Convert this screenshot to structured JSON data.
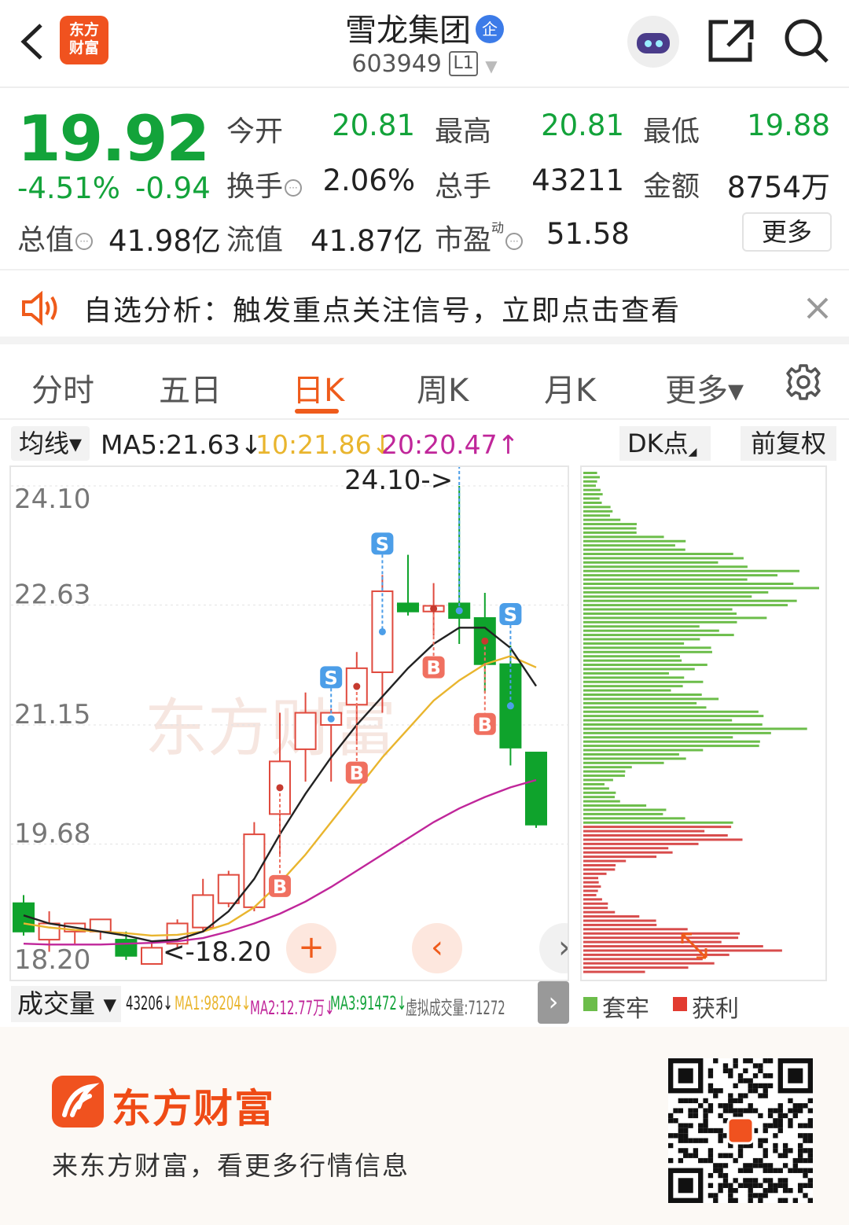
{
  "header": {
    "back_icon": "chevron-left-icon",
    "app_logo_text": "东方\n财富",
    "stock_name": "雪龙集团",
    "enterprise_badge": "企",
    "stock_code": "603949",
    "level_badge": "L1",
    "share_icon": "share-icon",
    "search_icon": "search-icon"
  },
  "quote": {
    "price": "19.92",
    "change_pct": "-4.51%",
    "change_amt": "-0.94",
    "open_label": "今开",
    "open_value": "20.81",
    "high_label": "最高",
    "high_value": "20.81",
    "low_label": "最低",
    "low_value": "19.88",
    "turnover_label": "换手",
    "turnover_value": "2.06%",
    "volume_label": "总手",
    "volume_value": "43211",
    "amount_label": "金额",
    "amount_value": "8754万",
    "mcap_label": "总值",
    "mcap_value": "41.98亿",
    "float_label": "流值",
    "float_value": "41.87亿",
    "pe_label": "市盈",
    "pe_superscript": "动",
    "pe_value": "51.58",
    "more_label": "更多",
    "colors": {
      "down": "#13a33a",
      "up": "#e23b30"
    }
  },
  "notice": {
    "text": "自选分析：触发重点关注信号，立即点击查看"
  },
  "tabs": [
    {
      "label": "分时"
    },
    {
      "label": "五日"
    },
    {
      "label": "日K",
      "active": true
    },
    {
      "label": "周K"
    },
    {
      "label": "月K"
    },
    {
      "label": "更多▾"
    }
  ],
  "ma": {
    "selector": "均线▾",
    "ma5": "MA5:21.63↓",
    "ma10": "10:21.86↓",
    "ma20": "20:20.47↑",
    "dk_label": "DK点",
    "adjust_label": "前复权"
  },
  "chart_data": {
    "type": "candlestick",
    "y_ticks": [
      "24.10",
      "22.63",
      "21.15",
      "19.68",
      "18.20"
    ],
    "ylim": [
      18.2,
      24.1
    ],
    "high_marker": "24.10->",
    "low_marker": "<-18.20",
    "candles": [
      {
        "o": 18.95,
        "c": 18.6,
        "h": 19.05,
        "l": 18.55
      },
      {
        "o": 18.5,
        "c": 18.7,
        "h": 18.85,
        "l": 18.35
      },
      {
        "o": 18.6,
        "c": 18.7,
        "h": 18.7,
        "l": 18.45
      },
      {
        "o": 18.6,
        "c": 18.75,
        "h": 18.75,
        "l": 18.5
      },
      {
        "o": 18.5,
        "c": 18.3,
        "h": 18.6,
        "l": 18.25
      },
      {
        "o": 18.2,
        "c": 18.4,
        "h": 18.45,
        "l": 18.2
      },
      {
        "o": 18.45,
        "c": 18.7,
        "h": 18.75,
        "l": 18.4
      },
      {
        "o": 18.65,
        "c": 19.05,
        "h": 19.25,
        "l": 18.6
      },
      {
        "o": 18.95,
        "c": 19.3,
        "h": 19.35,
        "l": 18.9
      },
      {
        "o": 18.9,
        "c": 19.8,
        "h": 19.95,
        "l": 18.85
      },
      {
        "o": 20.05,
        "c": 20.7,
        "h": 21.3,
        "l": 19.55
      },
      {
        "o": 20.85,
        "c": 21.3,
        "h": 21.55,
        "l": 20.45
      },
      {
        "o": 21.15,
        "c": 21.3,
        "h": 21.35,
        "l": 20.45
      },
      {
        "o": 21.4,
        "c": 21.85,
        "h": 22.05,
        "l": 20.95
      },
      {
        "o": 21.8,
        "c": 22.8,
        "h": 23.0,
        "l": 21.3
      },
      {
        "o": 22.65,
        "c": 22.55,
        "h": 23.25,
        "l": 22.5
      },
      {
        "o": 22.55,
        "c": 22.62,
        "h": 22.9,
        "l": 22.25
      },
      {
        "o": 22.65,
        "c": 22.47,
        "h": 24.1,
        "l": 22.15
      },
      {
        "o": 22.47,
        "c": 21.9,
        "h": 22.78,
        "l": 21.55
      },
      {
        "o": 21.9,
        "c": 20.87,
        "h": 22.13,
        "l": 20.65
      },
      {
        "o": 20.81,
        "c": 19.92,
        "h": 20.81,
        "l": 19.88
      }
    ],
    "ma5": [
      18.8,
      18.7,
      18.65,
      18.6,
      18.55,
      18.48,
      18.5,
      18.6,
      18.85,
      19.25,
      19.8,
      20.3,
      20.75,
      21.15,
      21.5,
      21.85,
      22.15,
      22.35,
      22.35,
      22.1,
      21.63
    ],
    "ma10": [
      18.7,
      18.65,
      18.62,
      18.6,
      18.58,
      18.55,
      18.56,
      18.6,
      18.7,
      18.9,
      19.2,
      19.55,
      19.95,
      20.35,
      20.75,
      21.1,
      21.45,
      21.7,
      21.9,
      22.0,
      21.86
    ],
    "ma20": [
      18.45,
      18.44,
      18.44,
      18.44,
      18.45,
      18.46,
      18.48,
      18.52,
      18.6,
      18.7,
      18.82,
      18.97,
      19.15,
      19.35,
      19.55,
      19.75,
      19.95,
      20.12,
      20.26,
      20.38,
      20.47
    ],
    "signals": [
      {
        "i": 10,
        "type": "B"
      },
      {
        "i": 12,
        "type": "S"
      },
      {
        "i": 13,
        "type": "B"
      },
      {
        "i": 14,
        "type": "S"
      },
      {
        "i": 16,
        "type": "B"
      },
      {
        "i": 17,
        "type": "S"
      },
      {
        "i": 18,
        "type": "B"
      },
      {
        "i": 19,
        "type": "S"
      }
    ],
    "watermark": "东方财富",
    "distribution": {
      "profit_color": "#d84c4c",
      "trapped_color": "#6cbd4a",
      "levels_count": 118
    }
  },
  "volume": {
    "selector": "成交量 ▾",
    "vol": "43206↓",
    "ma1": "MA1:98204↓",
    "ma2": "MA2:12.77万↓",
    "ma3": "MA3:91472↓",
    "virtual": "虚拟成交量:71272"
  },
  "legend": {
    "trapped": "套牢",
    "profit": "获利"
  },
  "footer": {
    "brand": "东方财富",
    "slogan": "来东方财富，看更多行情信息"
  }
}
